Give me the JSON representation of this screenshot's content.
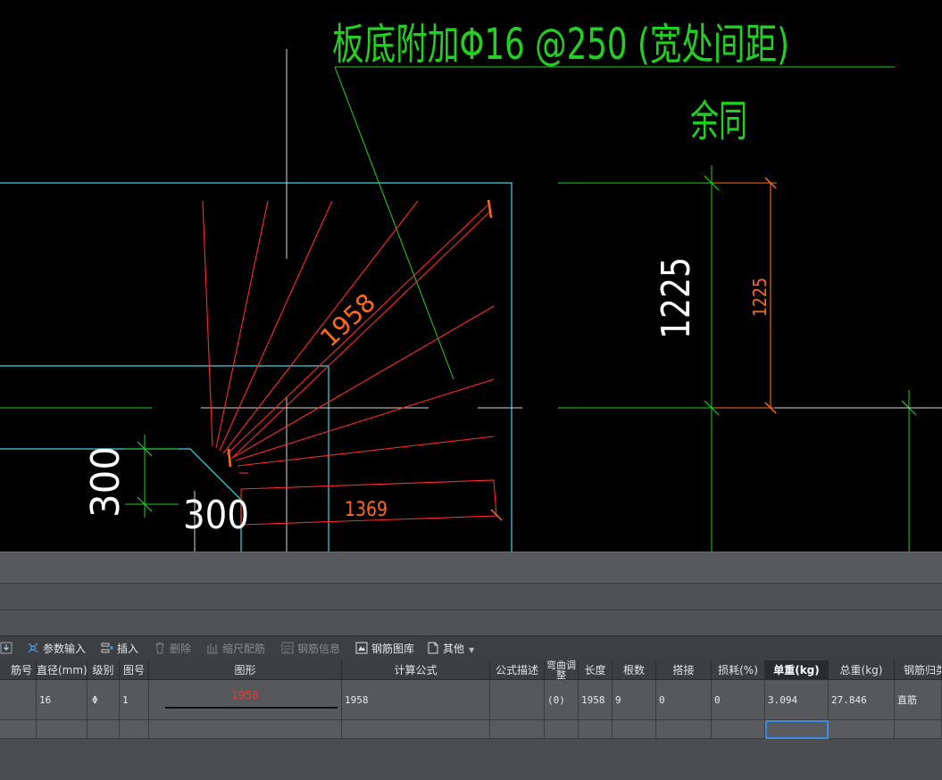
{
  "cad": {
    "annotation_main": "板底附加Φ16 @250 (宽处间距)",
    "annotation_sub": "余同",
    "dim_1958": "1958",
    "dim_1369": "1369",
    "dim_1225_large": "1225",
    "dim_1225_small": "1225",
    "dim_300_a": "300",
    "dim_300_b": "300"
  },
  "toolbar": {
    "items": [
      {
        "label": "参数输入",
        "icon": "param-input-icon",
        "enabled": true
      },
      {
        "label": "插入",
        "icon": "insert-icon",
        "enabled": true
      },
      {
        "label": "删除",
        "icon": "delete-icon",
        "enabled": false
      },
      {
        "label": "缩尺配筋",
        "icon": "scale-rebar-icon",
        "enabled": false
      },
      {
        "label": "钢筋信息",
        "icon": "rebar-info-icon",
        "enabled": false
      },
      {
        "label": "钢筋图库",
        "icon": "rebar-library-icon",
        "enabled": true
      },
      {
        "label": "其他",
        "icon": "other-icon",
        "enabled": true
      }
    ]
  },
  "table": {
    "headers": [
      "筋号",
      "直径(mm)",
      "级别",
      "图号",
      "图形",
      "计算公式",
      "公式描述",
      "弯曲调整",
      "长度",
      "根数",
      "搭接",
      "损耗(%)",
      "单重(kg)",
      "总重(kg)",
      "钢筋归类"
    ],
    "row": {
      "diameter": "16",
      "grade": "Φ",
      "figure_no": "1",
      "shape_label": "1958",
      "formula": "1958",
      "formula_desc": "",
      "bend_adjust": "(0)",
      "length": "1958",
      "count": "9",
      "lap": "0",
      "loss": "0",
      "unit_weight": "3.094",
      "total_weight": "27.846",
      "category": "直筋"
    }
  },
  "colors": {
    "cad_background": "#000000",
    "boundary": "#3fd4e0",
    "axis": "#22d022",
    "rebar": "#ff2a2a",
    "dimension_tick": "#ff6a1a",
    "selection": "#3d8ee0"
  }
}
